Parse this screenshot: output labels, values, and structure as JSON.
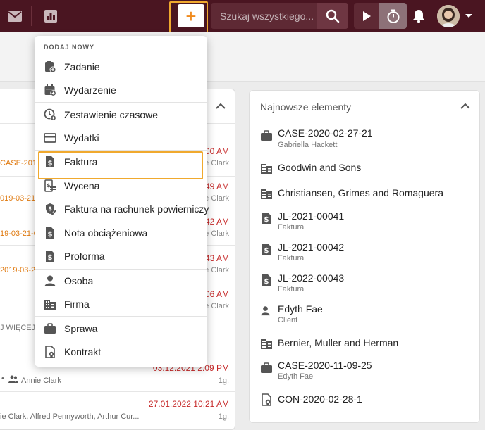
{
  "search": {
    "placeholder": "Szukaj wszystkiego..."
  },
  "add_button": {
    "symbol": "+"
  },
  "colors": {
    "topbar": "#4a1521",
    "accent": "#f08a1c",
    "highlight": "#f0a92e",
    "date_red": "#c62828"
  },
  "menu": {
    "header": "DODAJ NOWY",
    "items": [
      {
        "label": "Zadanie",
        "icon": "task-add-icon"
      },
      {
        "label": "Wydarzenie",
        "icon": "calendar-add-icon"
      },
      {
        "label": "Zestawienie czasowe",
        "icon": "clock-add-icon"
      },
      {
        "label": "Wydatki",
        "icon": "credit-card-icon"
      },
      {
        "label": "Faktura",
        "icon": "invoice-icon"
      },
      {
        "label": "Wycena",
        "icon": "quote-icon"
      },
      {
        "label": "Faktura na rachunek powierniczy",
        "icon": "trust-invoice-icon"
      },
      {
        "label": "Nota obciążeniowa",
        "icon": "debit-note-icon"
      },
      {
        "label": "Proforma",
        "icon": "proforma-icon"
      },
      {
        "label": "Osoba",
        "icon": "person-icon"
      },
      {
        "label": "Firma",
        "icon": "company-icon"
      },
      {
        "label": "Sprawa",
        "icon": "briefcase-icon"
      },
      {
        "label": "Kontrakt",
        "icon": "contract-icon"
      }
    ]
  },
  "left_panel": {
    "rows": [
      {
        "time": "00 AM",
        "user": "e Clark",
        "ref": "CASE-2019"
      },
      {
        "time": "49 AM",
        "user": "e Clark",
        "ref": "019-03-21-"
      },
      {
        "time": "42 AM",
        "user": "e Clark",
        "ref": "19-03-21-0"
      },
      {
        "time": "43 AM",
        "user": "e Clark",
        "ref": "2019-03-21"
      },
      {
        "time": "06 AM",
        "user": "e Clark",
        "ref": ""
      }
    ],
    "more": "J WIĘCEJ Z",
    "bottom_rows": [
      {
        "time": "03.12.2021 2:09 PM",
        "users": "Annie Clark",
        "count": "1g."
      },
      {
        "time": "27.01.2022 10:21 AM",
        "users": "ie Clark, Alfred Pennyworth, Arthur Cur...",
        "count": "1g."
      }
    ]
  },
  "recent": {
    "title": "Najnowsze elementy",
    "items": [
      {
        "title": "CASE-2020-02-27-21",
        "sub": "Gabriella Hackett",
        "icon": "briefcase-icon"
      },
      {
        "title": "Goodwin and Sons",
        "sub": "",
        "icon": "company-icon"
      },
      {
        "title": "Christiansen, Grimes and Romaguera",
        "sub": "",
        "icon": "company-icon"
      },
      {
        "title": "JL-2021-00041",
        "sub": "Faktura",
        "icon": "invoice-icon"
      },
      {
        "title": "JL-2021-00042",
        "sub": "Faktura",
        "icon": "invoice-icon"
      },
      {
        "title": "JL-2022-00043",
        "sub": "Faktura",
        "icon": "invoice-icon"
      },
      {
        "title": "Edyth Fae",
        "sub": "Client",
        "icon": "person-icon"
      },
      {
        "title": "Bernier, Muller and Herman",
        "sub": "",
        "icon": "company-icon"
      },
      {
        "title": "CASE-2020-11-09-25",
        "sub": "Edyth Fae",
        "icon": "briefcase-icon"
      },
      {
        "title": "CON-2020-02-28-1",
        "sub": "",
        "icon": "contract-icon"
      }
    ]
  }
}
